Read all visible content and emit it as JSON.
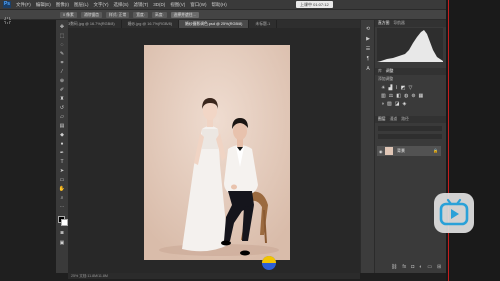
{
  "app": {
    "logo_text": "Ps"
  },
  "menubar": {
    "items": [
      "文件(F)",
      "编辑(E)",
      "图像(I)",
      "图层(L)",
      "文字(Y)",
      "选择(S)",
      "滤镜(T)",
      "3D(D)",
      "视图(V)",
      "窗口(W)",
      "帮助(H)"
    ],
    "upload_label": "上课中 01:07:12",
    "window_controls": [
      "—",
      "□",
      "✕"
    ]
  },
  "options": {
    "items": [
      "0 像素",
      "消除锯齿",
      "样式: 正常",
      "宽度:",
      "高度:",
      "选择并遮住..."
    ]
  },
  "tabs": [
    {
      "label": "03数码.jpg @ 16.7%(RGB/8)"
    },
    {
      "label": "婚纱.jpg @ 16.7%(RGB/8)"
    },
    {
      "label": "婚纱摄影调色.psd @ 25%(RGB/8)"
    },
    {
      "label": "未标题-1"
    }
  ],
  "status": {
    "text": "25%   文档:11.8M/11.8M"
  },
  "panels": {
    "top_tabs": [
      "直方图",
      "导航器"
    ],
    "adjust_tabs": [
      "库",
      "调整"
    ],
    "adjust_title": "添加调整",
    "layer_tabs": [
      "图层",
      "通道",
      "路径"
    ],
    "layer_name": "背景"
  },
  "colors": {
    "accent": "#4aa3ff",
    "bilibili_blue": "#2aa1d8",
    "red_border": "#c41d1d"
  },
  "icons": {
    "overlay": "bilibili-tv-icon"
  }
}
